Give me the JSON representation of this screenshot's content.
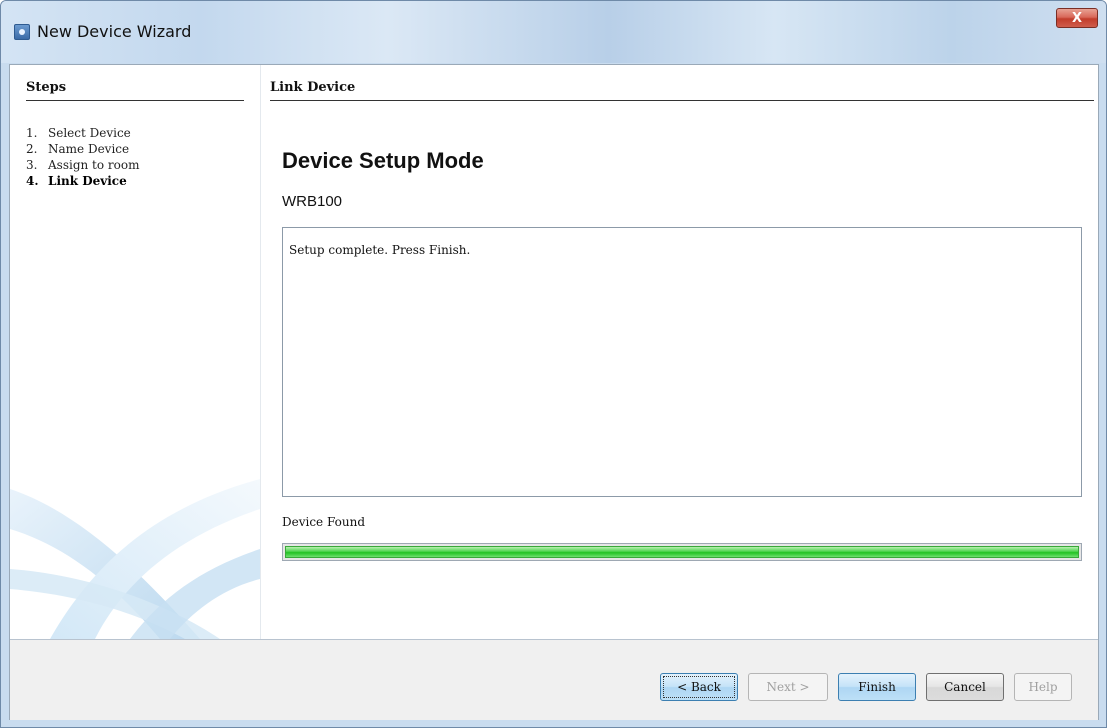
{
  "window": {
    "title": "New Device Wizard",
    "close_symbol": "X",
    "icon": "wizard-app-icon"
  },
  "sidebar": {
    "title": "Steps",
    "steps": [
      {
        "num": "1.",
        "label": "Select Device"
      },
      {
        "num": "2.",
        "label": "Name Device"
      },
      {
        "num": "3.",
        "label": "Assign to room"
      },
      {
        "num": "4.",
        "label": "Link Device"
      }
    ],
    "current_step": 4
  },
  "main": {
    "header": "Link Device",
    "heading": "Device Setup Mode",
    "device_model": "WRB100",
    "log_text": "Setup complete. Press Finish.",
    "status_label": "Device Found",
    "progress_percent": 100
  },
  "footer": {
    "back_label": "< Back",
    "next_label": "Next >",
    "finish_label": "Finish",
    "cancel_label": "Cancel",
    "help_label": "Help"
  },
  "colors": {
    "progress_fill": "#21c221",
    "close_button": "#c23d2b",
    "titlebar": "#c9dcef"
  }
}
